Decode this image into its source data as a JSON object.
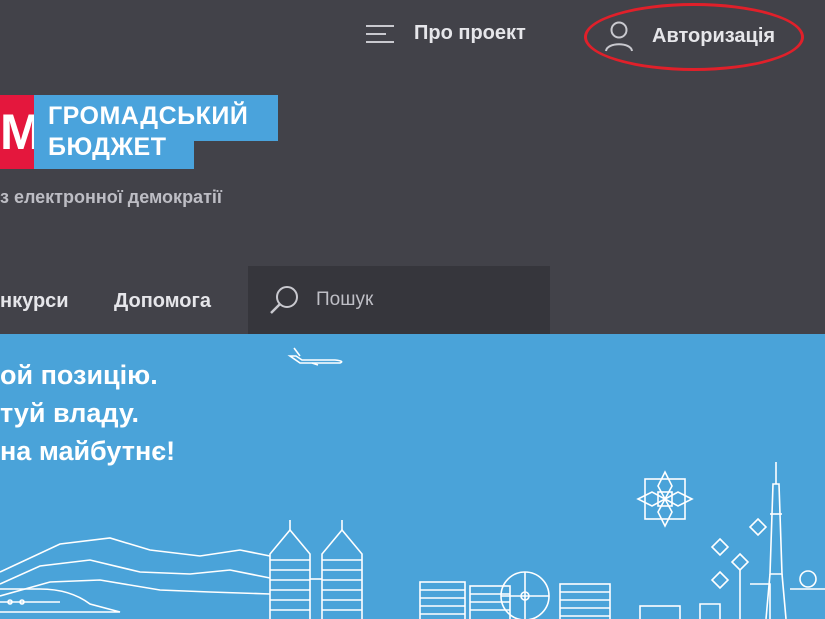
{
  "header": {
    "about_label": "Про проект",
    "auth_label": "Авторизація",
    "logo_letter": "М",
    "logo_line1": "ГРОМАДСЬКИЙ",
    "logo_line2": "БЮДЖЕТ",
    "tagline": "з електронної демократії"
  },
  "menu": {
    "items": [
      {
        "label": "нкурси"
      },
      {
        "label": "Допомога"
      }
    ]
  },
  "search": {
    "placeholder": "Пошук"
  },
  "banner": {
    "lines": [
      "ой позицію.",
      "туй владу.",
      "на майбутнє!"
    ]
  },
  "colors": {
    "header_bg": "#424249",
    "banner_bg": "#4aa3d9",
    "logo_red": "#e4173d",
    "logo_blue": "#4aa3dc",
    "highlight": "#e0202a"
  }
}
